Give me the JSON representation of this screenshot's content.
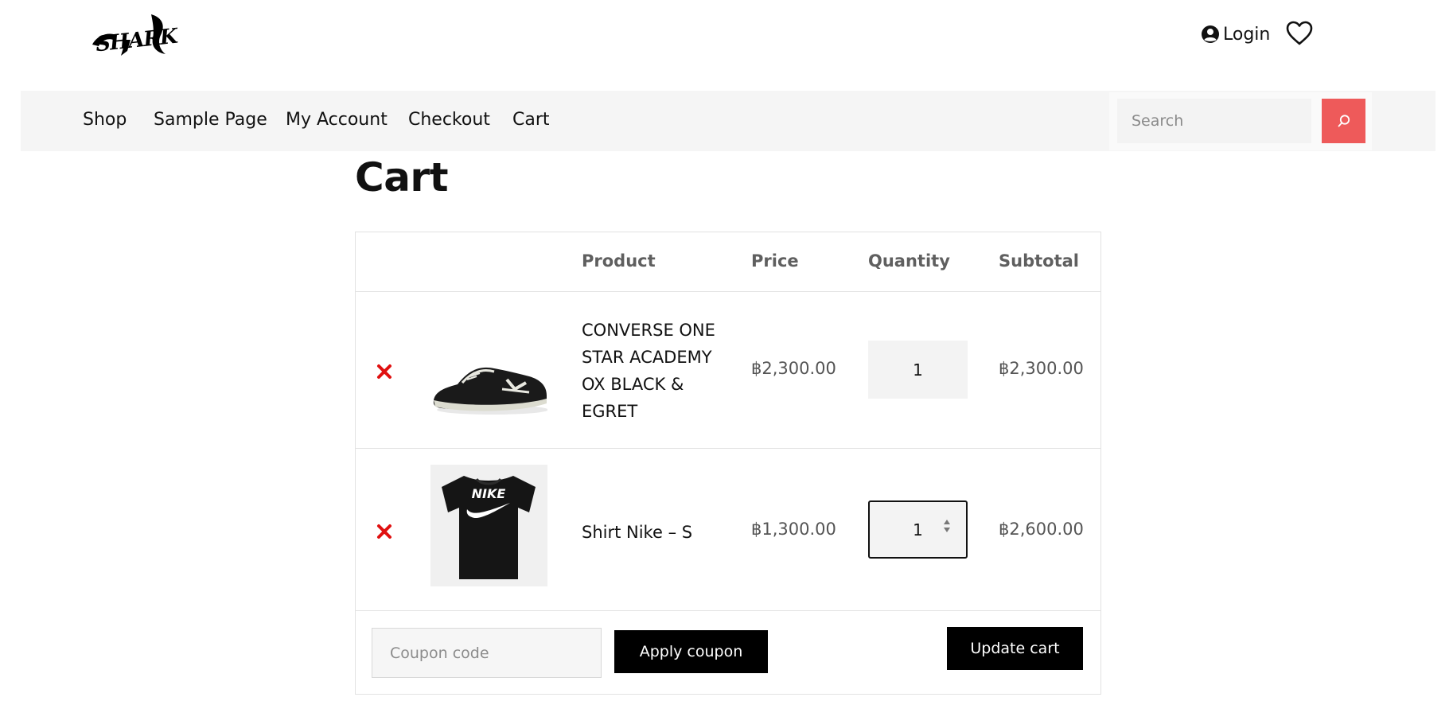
{
  "header": {
    "logo_text": "SHARK",
    "login_label": "Login"
  },
  "nav": {
    "items": [
      "Shop",
      "Sample Page",
      "My Account",
      "Checkout",
      "Cart"
    ],
    "search_placeholder": "Search"
  },
  "page": {
    "title": "Cart"
  },
  "cart": {
    "columns": {
      "product": "Product",
      "price": "Price",
      "quantity": "Quantity",
      "subtotal": "Subtotal"
    },
    "items": [
      {
        "name_lines": [
          "CONVERSE ONE",
          "STAR ACADEMY",
          "OX BLACK &",
          "EGRET"
        ],
        "price": "฿2,300.00",
        "quantity": "1",
        "subtotal": "฿2,300.00"
      },
      {
        "name_lines": [
          "Shirt Nike – S"
        ],
        "price": "฿1,300.00",
        "quantity": "1",
        "subtotal": "฿2,600.00"
      }
    ],
    "coupon_placeholder": "Coupon code",
    "apply_coupon_label": "Apply coupon",
    "update_cart_label": "Update cart"
  },
  "colors": {
    "search_button": "#ee5a5a",
    "remove_icon": "#e01010",
    "nav_background": "#f5f5f5"
  },
  "icons": [
    "shark-logo",
    "user-circle-icon",
    "heart-icon",
    "search-icon",
    "remove-x-icon",
    "shoe-thumbnail",
    "tshirt-thumbnail",
    "spinner-icon"
  ]
}
